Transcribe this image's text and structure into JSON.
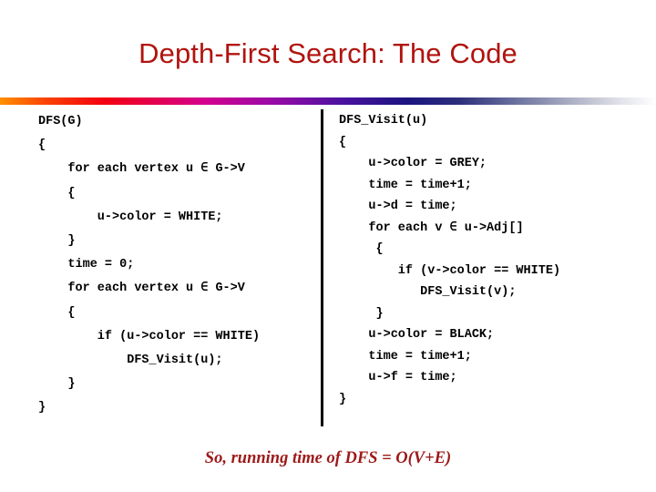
{
  "slide": {
    "title": "Depth-First Search: The Code",
    "title_color": "#b01410",
    "background_color": "#ffffff",
    "divider_color": "#000000",
    "footer_color": "#9c1a18",
    "rule_gradient_stops": [
      "#ff9000",
      "#f30010",
      "#d4008c",
      "#9c0aa6",
      "#4c12a0",
      "#1b1480",
      "#6d74a0",
      "#b3b6c8",
      "#ffffff"
    ]
  },
  "code_left": {
    "name": "DFS",
    "lines": [
      "DFS(G)",
      "{",
      "    for each vertex u ∈ G->V",
      "    {",
      "        u->color = WHITE;",
      "    }",
      "    time = 0;",
      "    for each vertex u ∈ G->V",
      "    {",
      "        if (u->color == WHITE)",
      "            DFS_Visit(u);",
      "    }",
      "}"
    ]
  },
  "code_right": {
    "name": "DFS_Visit",
    "lines": [
      "DFS_Visit(u)",
      "{",
      "    u->color = GREY;",
      "    time = time+1;",
      "    u->d = time;",
      "    for each v ∈ u->Adj[]",
      "     {",
      "        if (v->color == WHITE)",
      "           DFS_Visit(v);",
      "     }",
      "    u->color = BLACK;",
      "    time = time+1;",
      "    u->f = time;",
      "}"
    ]
  },
  "footer": {
    "text": "So, running time of DFS = O(V+E)"
  }
}
